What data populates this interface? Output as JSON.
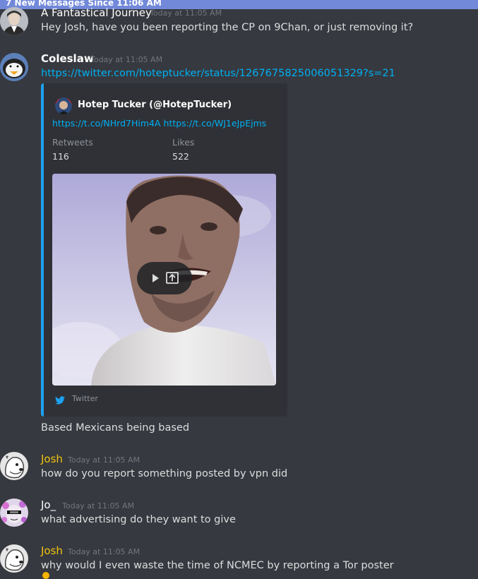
{
  "banner": {
    "text": "7 New Messages Since 11:06 AM"
  },
  "colors": {
    "background": "#36393f",
    "embed_bg": "#2f3136",
    "embed_accent": "#1da1f2",
    "link": "#00b0f4",
    "banner": "#7289da",
    "username_gold": "#f1c40f"
  },
  "messages": [
    {
      "author": "A Fantastical Journey",
      "timestamp": "Today at 11:05 AM",
      "text": "Hey Josh, have you been reporting the CP on 9Chan, or just removing it?"
    },
    {
      "author": "Coleslaw",
      "timestamp": "Today at 11:05 AM",
      "link": "https://twitter.com/hoteptucker/status/1267675825006051329?s=21",
      "embed": {
        "author": "Hotep Tucker (@HotepTucker)",
        "description": "https://t.co/NHrd7Him4A https://t.co/WJ1eJpEjms",
        "fields": [
          {
            "name": "Retweets",
            "value": "116"
          },
          {
            "name": "Likes",
            "value": "522"
          }
        ],
        "footer": "Twitter"
      },
      "text": "Based Mexicans being based"
    },
    {
      "author": "Josh",
      "timestamp": "Today at 11:05 AM",
      "text": "how do you report something posted by vpn did"
    },
    {
      "author": "Jo_",
      "timestamp": "Today at 11:05 AM",
      "text": "what advertising do they want to give"
    },
    {
      "author": "Josh",
      "timestamp": "Today at 11:05 AM",
      "text": "why would I even waste the time of NCMEC by reporting a Tor poster"
    }
  ]
}
